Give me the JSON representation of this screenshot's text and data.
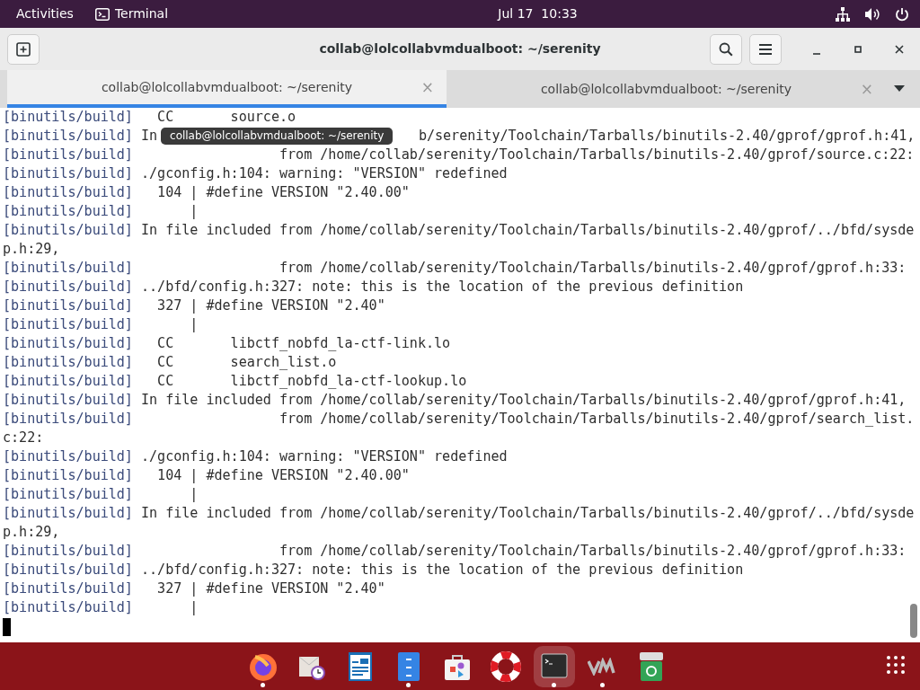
{
  "top_bar": {
    "activities": "Activities",
    "app_name": "Terminal",
    "clock": "Jul 17  10:33"
  },
  "window": {
    "title": "collab@lolcollabvmdualboot: ~/serenity"
  },
  "tabs": [
    {
      "label": "collab@lolcollabvmdualboot: ~/serenity",
      "selected": true,
      "close": "×"
    },
    {
      "label": "collab@lolcollabvmdualboot: ~/serenity",
      "selected": false,
      "close": "×"
    }
  ],
  "tooltip": "collab@lolcollabvmdualboot: ~/serenity",
  "terminal": {
    "lines": [
      {
        "prefix": "[binutils/build]",
        "text": "  CC       source.o"
      },
      {
        "prefix": "[binutils/build]",
        "text": "In",
        "after_tooltip": "b/serenity/Toolchain/Tarballs/binutils-2.40/gprof/gprof.h:41,"
      },
      {
        "prefix": "[binutils/build]",
        "text": "                 from /home/collab/serenity/Toolchain/Tarballs/binutils-2.40/gprof/source.c:22:"
      },
      {
        "prefix": "[binutils/build]",
        "text": "./gconfig.h:104: warning: \"VERSION\" redefined"
      },
      {
        "prefix": "[binutils/build]",
        "text": "  104 | #define VERSION \"2.40.00\""
      },
      {
        "prefix": "[binutils/build]",
        "text": "      |"
      },
      {
        "prefix": "[binutils/build]",
        "text": "In file included from /home/collab/serenity/Toolchain/Tarballs/binutils-2.40/gprof/../bfd/sysde"
      },
      {
        "text": "p.h:29,"
      },
      {
        "prefix": "[binutils/build]",
        "text": "                 from /home/collab/serenity/Toolchain/Tarballs/binutils-2.40/gprof/gprof.h:33:"
      },
      {
        "prefix": "[binutils/build]",
        "text": "../bfd/config.h:327: note: this is the location of the previous definition"
      },
      {
        "prefix": "[binutils/build]",
        "text": "  327 | #define VERSION \"2.40\""
      },
      {
        "prefix": "[binutils/build]",
        "text": "      |"
      },
      {
        "prefix": "[binutils/build]",
        "text": "  CC       libctf_nobfd_la-ctf-link.lo"
      },
      {
        "prefix": "[binutils/build]",
        "text": "  CC       search_list.o"
      },
      {
        "prefix": "[binutils/build]",
        "text": "  CC       libctf_nobfd_la-ctf-lookup.lo"
      },
      {
        "prefix": "[binutils/build]",
        "text": "In file included from /home/collab/serenity/Toolchain/Tarballs/binutils-2.40/gprof/gprof.h:41,"
      },
      {
        "prefix": "[binutils/build]",
        "text": "                 from /home/collab/serenity/Toolchain/Tarballs/binutils-2.40/gprof/search_list."
      },
      {
        "text": "c:22:"
      },
      {
        "prefix": "[binutils/build]",
        "text": "./gconfig.h:104: warning: \"VERSION\" redefined"
      },
      {
        "prefix": "[binutils/build]",
        "text": "  104 | #define VERSION \"2.40.00\""
      },
      {
        "prefix": "[binutils/build]",
        "text": "      |"
      },
      {
        "prefix": "[binutils/build]",
        "text": "In file included from /home/collab/serenity/Toolchain/Tarballs/binutils-2.40/gprof/../bfd/sysde"
      },
      {
        "text": "p.h:29,"
      },
      {
        "prefix": "[binutils/build]",
        "text": "                 from /home/collab/serenity/Toolchain/Tarballs/binutils-2.40/gprof/gprof.h:33:"
      },
      {
        "prefix": "[binutils/build]",
        "text": "../bfd/config.h:327: note: this is the location of the previous definition"
      },
      {
        "prefix": "[binutils/build]",
        "text": "  327 | #define VERSION \"2.40\""
      },
      {
        "prefix": "[binutils/build]",
        "text": "      |"
      }
    ]
  },
  "dock": [
    {
      "running": true,
      "selected": false
    },
    {
      "running": false,
      "selected": false
    },
    {
      "running": false,
      "selected": false
    },
    {
      "running": true,
      "selected": false
    },
    {
      "running": false,
      "selected": false
    },
    {
      "running": false,
      "selected": false
    },
    {
      "running": true,
      "selected": true
    },
    {
      "running": true,
      "selected": false
    },
    {
      "running": false,
      "selected": false
    }
  ]
}
